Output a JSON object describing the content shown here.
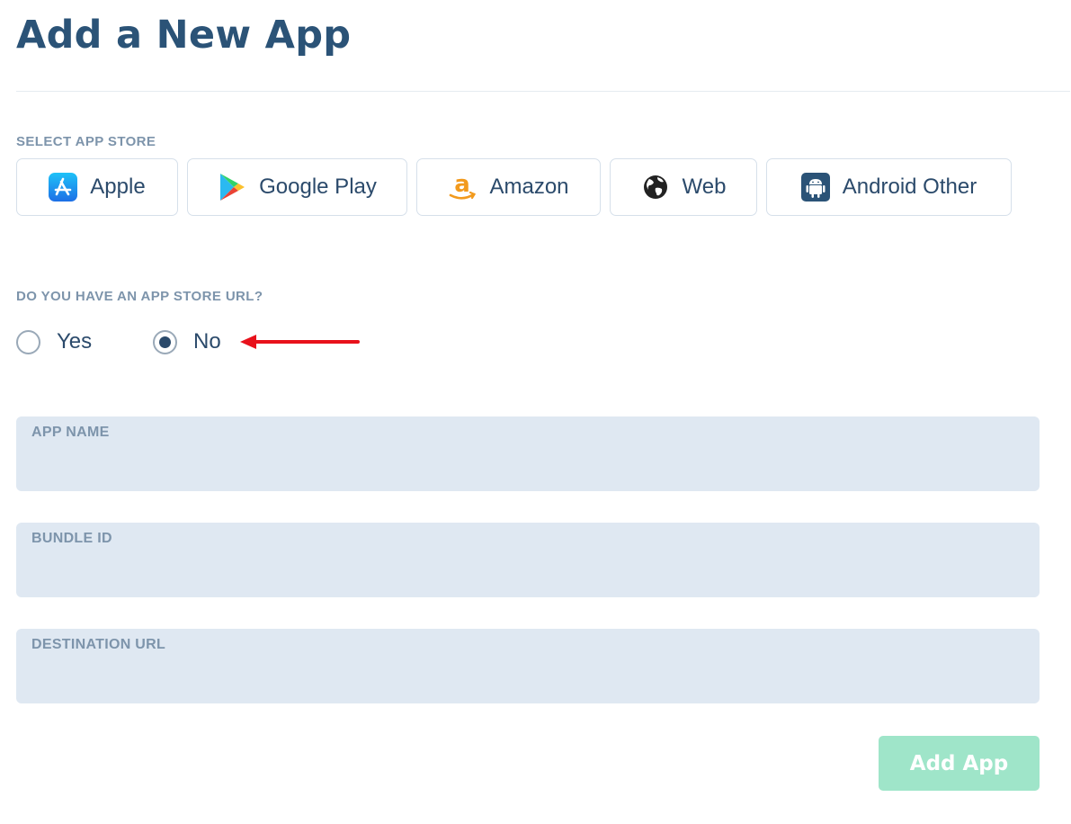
{
  "page": {
    "title": "Add a New App"
  },
  "store_section": {
    "label": "SELECT APP STORE",
    "stores": [
      {
        "label": "Apple",
        "icon": "apple-app-store-icon"
      },
      {
        "label": "Google Play",
        "icon": "google-play-icon"
      },
      {
        "label": "Amazon",
        "icon": "amazon-icon"
      },
      {
        "label": "Web",
        "icon": "globe-icon"
      },
      {
        "label": "Android Other",
        "icon": "android-icon"
      }
    ]
  },
  "url_question": {
    "label": "DO YOU HAVE AN APP STORE URL?",
    "options": [
      {
        "label": "Yes",
        "selected": false
      },
      {
        "label": "No",
        "selected": true
      }
    ]
  },
  "fields": {
    "app_name": {
      "label": "APP NAME",
      "value": ""
    },
    "bundle_id": {
      "label": "BUNDLE ID",
      "value": ""
    },
    "destination_url": {
      "label": "DESTINATION URL",
      "value": ""
    }
  },
  "actions": {
    "add_label": "Add App"
  },
  "colors": {
    "title": "#2b5377",
    "muted_label": "#7d94ab",
    "field_bg": "#dfe8f2",
    "add_button_bg": "#9fe5c9",
    "arrow": "#e8111b"
  }
}
